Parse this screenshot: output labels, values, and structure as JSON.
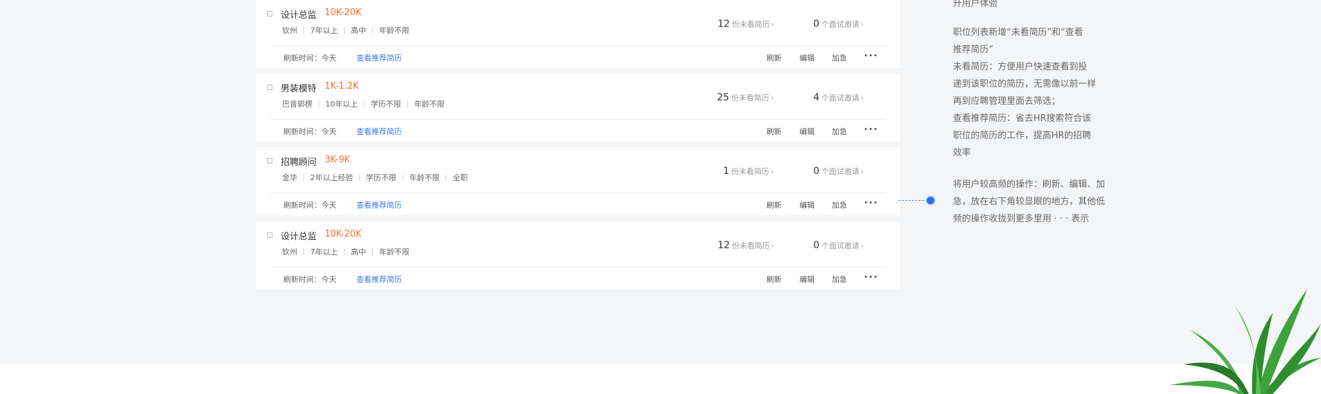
{
  "side_notes": {
    "head_fragment": "升用户体验",
    "block1": [
      "职位列表新增“未看简历”和“查看",
      "推荐简历”",
      "未看简历：方便用户快速查看到投",
      "递到该职位的简历，无需像以前一样",
      "再到应聘管理里面去筛选；",
      "查看推荐简历：省去HR搜索符合该",
      "职位的简历的工作，提高HR的招聘",
      "效率"
    ],
    "block2": [
      "将用户较高频的操作：刷新、编辑、加",
      "急，放在右下角较显眼的地方，其他低",
      "频的操作收拢到更多里用 · · · 表示"
    ]
  },
  "jobs": [
    {
      "title": "设计总监",
      "salary": "10K-20K",
      "tags": [
        "钦州",
        "7年以上",
        "高中",
        "年龄不限"
      ],
      "unviewed_count": "12",
      "unviewed_label": "份未看简历",
      "interview_count": "0",
      "interview_label": "个面试邀请",
      "refresh_time": "刷新时间：今天",
      "recommend_link": "查看推荐简历",
      "actions": {
        "refresh": "刷新",
        "edit": "编辑",
        "urgent": "加急"
      }
    },
    {
      "title": "男装模特",
      "salary": "1K-1.2K",
      "tags": [
        "巴音郭楞",
        "10年以上",
        "学历不限",
        "年龄不限"
      ],
      "unviewed_count": "25",
      "unviewed_label": "份未看简历",
      "interview_count": "4",
      "interview_label": "个面试邀请",
      "refresh_time": "刷新时间：今天",
      "recommend_link": "查看推荐简历",
      "actions": {
        "refresh": "刷新",
        "edit": "编辑",
        "urgent": "加急"
      }
    },
    {
      "title": "招聘顾问",
      "salary": "3K-9K",
      "tags": [
        "金华",
        "2年以上经验",
        "学历不限",
        "年龄不限",
        "全职"
      ],
      "unviewed_count": "1",
      "unviewed_label": "份未看简历",
      "interview_count": "0",
      "interview_label": "个面试邀请",
      "refresh_time": "刷新时间：今天",
      "recommend_link": "查看推荐简历",
      "actions": {
        "refresh": "刷新",
        "edit": "编辑",
        "urgent": "加急"
      }
    },
    {
      "title": "设计总监",
      "salary": "10K-20K",
      "tags": [
        "钦州",
        "7年以上",
        "高中",
        "年龄不限"
      ],
      "unviewed_count": "12",
      "unviewed_label": "份未看简历",
      "interview_count": "0",
      "interview_label": "个面试邀请",
      "refresh_time": "刷新时间：今天",
      "recommend_link": "查看推荐简历",
      "actions": {
        "refresh": "刷新",
        "edit": "编辑",
        "urgent": "加急"
      }
    }
  ],
  "colors": {
    "salary": "#ff6a2a",
    "link": "#3e7ce0",
    "connector": "#2f6fe3",
    "panel_bg": "#f4f5f7"
  },
  "icons": {
    "more": "more-dots-icon",
    "chevron": "chevron-right-icon",
    "plant": "plant-illustration"
  }
}
